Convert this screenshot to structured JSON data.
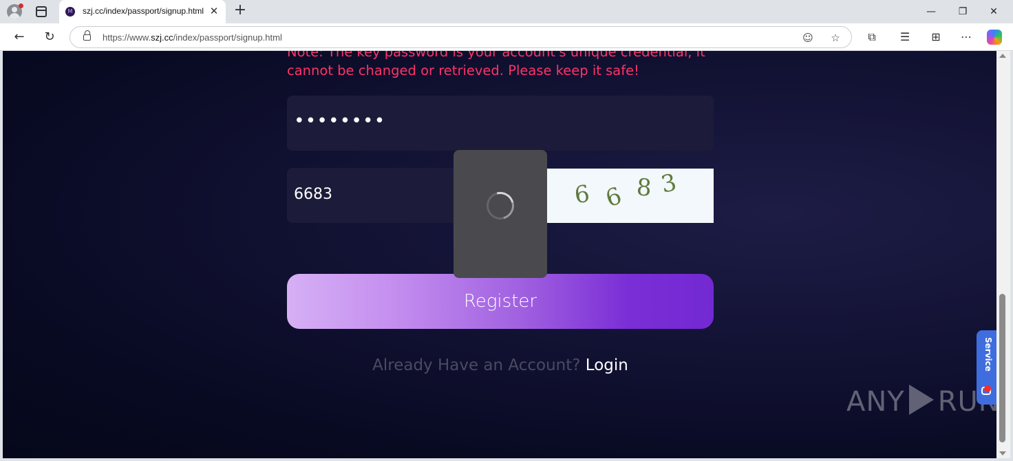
{
  "browser": {
    "tab_title": "szj.cc/index/passport/signup.html",
    "favicon_letter": "M",
    "url_prefix": "https://www.",
    "url_domain": "szj.cc",
    "url_path": "/index/passport/signup.html",
    "new_tab": "+",
    "close_tab": "✕",
    "minimize": "—",
    "restore": "❐",
    "close_window": "✕"
  },
  "page": {
    "note": "Note: The key password is your account's unique credential, it cannot be changed or retrieved. Please keep it safe!",
    "password_masked": "••••••••",
    "captcha_input_value": "6683",
    "captcha_digits": [
      "6",
      "6",
      "8",
      "3"
    ],
    "register_label": "Register",
    "login_prompt": "Already Have an Account?",
    "login_link": "Login",
    "service_label": "Service",
    "watermark_left": "ANY",
    "watermark_right": "RUN"
  },
  "colors": {
    "note": "#ff3366",
    "register_start": "#d6b0f5",
    "register_end": "#7329d2",
    "service_tab": "#3f6ddd",
    "page_bg": "#0b0c26"
  },
  "icons": [
    "profile-icon",
    "tab-actions-icon",
    "back-icon",
    "refresh-icon",
    "lock-icon",
    "reading-mode-icon",
    "favorite-star-icon",
    "extensions-icon",
    "favorites-icon",
    "collections-icon",
    "more-icon",
    "copilot-icon",
    "loading-spinner-icon",
    "chat-icon"
  ]
}
